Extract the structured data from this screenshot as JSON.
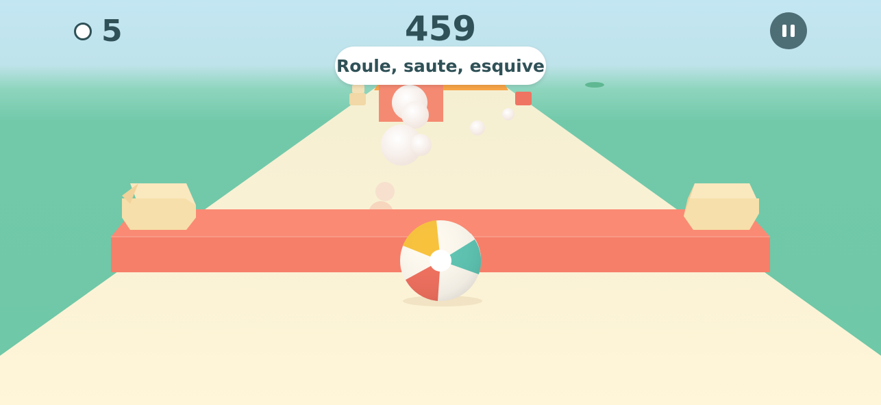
{
  "hud": {
    "coin_count": "5",
    "score": "459",
    "tip": "Roule, saute, esquive"
  },
  "icons": {
    "coin": "circle-coin-icon",
    "pause": "pause-icon",
    "ball": "beach-ball"
  },
  "colors": {
    "sky_top": "#c2e6f2",
    "water": "#72c9aa",
    "track": "#fbf0cd",
    "barrier": "#f9816d",
    "block": "#f6dfaa",
    "text": "#2f5157",
    "pause_bg": "#4e6e76",
    "ball_yellow": "#f8c23c",
    "ball_teal": "#5fc6b4",
    "ball_red": "#f1705e"
  }
}
